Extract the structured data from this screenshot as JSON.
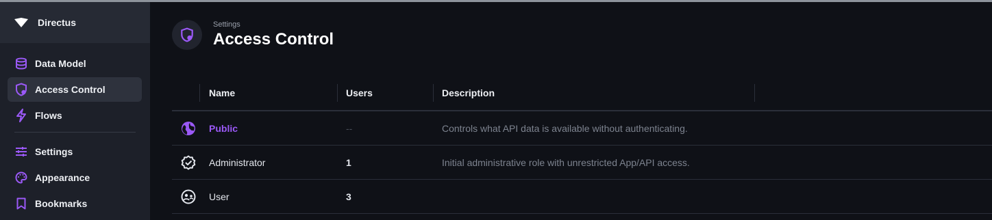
{
  "app": {
    "brand_name": "Directus"
  },
  "colors": {
    "accent": "#9b59f7",
    "sidebar_bg": "#1d2029",
    "main_bg": "#0f1117"
  },
  "sidebar": {
    "items": [
      {
        "label": "Data Model",
        "icon": "database-icon"
      },
      {
        "label": "Access Control",
        "icon": "shield-lock-icon",
        "active": true
      },
      {
        "label": "Flows",
        "icon": "bolt-icon"
      },
      {
        "label": "Settings",
        "icon": "sliders-icon"
      },
      {
        "label": "Appearance",
        "icon": "palette-icon"
      },
      {
        "label": "Bookmarks",
        "icon": "bookmark-icon"
      }
    ]
  },
  "header": {
    "breadcrumb": "Settings",
    "title": "Access Control"
  },
  "table": {
    "columns": [
      "Name",
      "Users",
      "Description"
    ],
    "rows": [
      {
        "icon": "globe-icon",
        "name": "Public",
        "users": "--",
        "description": "Controls what API data is available without authenticating."
      },
      {
        "icon": "verified-badge-icon",
        "name": "Administrator",
        "users": "1",
        "description": "Initial administrative role with unrestricted App/API access."
      },
      {
        "icon": "user-group-icon",
        "name": "User",
        "users": "3",
        "description": ""
      }
    ]
  }
}
